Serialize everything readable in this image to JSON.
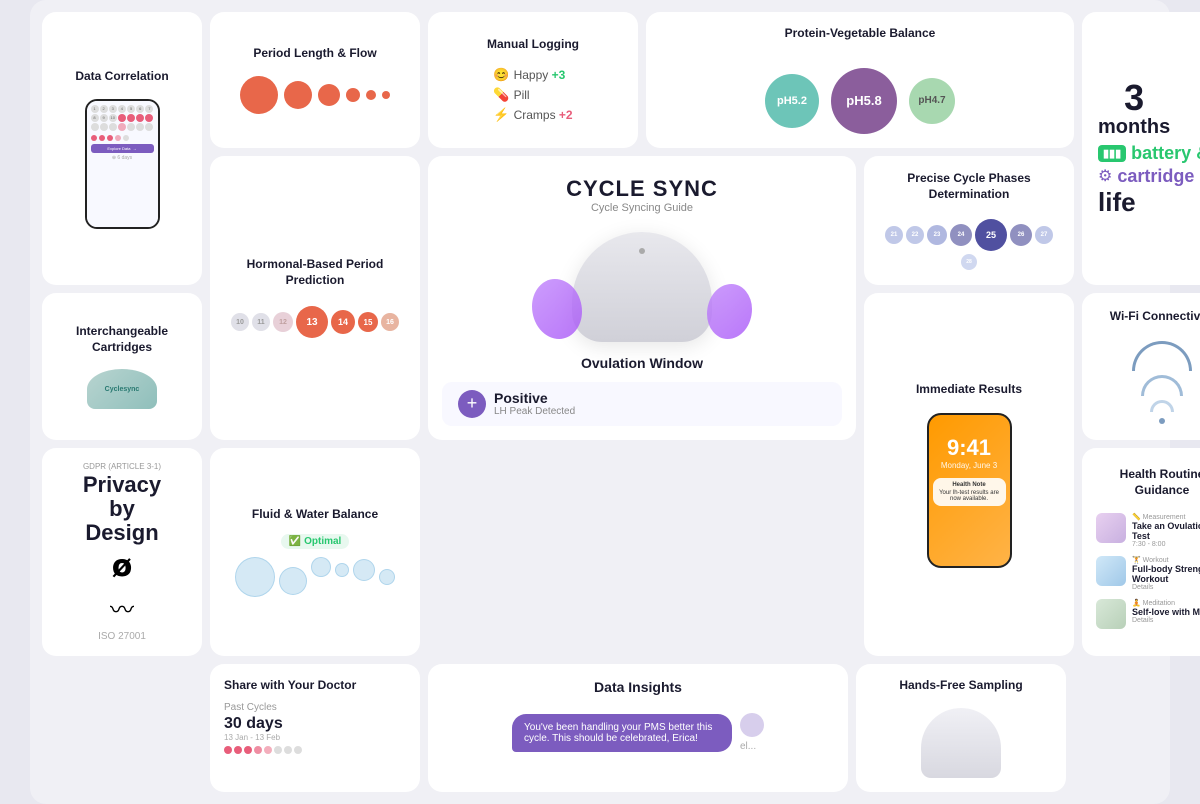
{
  "cards": {
    "data_correlation": {
      "title": "Data Correlation"
    },
    "period_flow": {
      "title": "Period Length & Flow",
      "circles": [
        38,
        28,
        22,
        14,
        10,
        8
      ]
    },
    "manual_logging": {
      "title": "Manual Logging",
      "items": [
        {
          "icon": "😊",
          "text": "Happy +3"
        },
        {
          "icon": "💊",
          "text": "Pill"
        },
        {
          "icon": "⚡",
          "text": "Cramps +2"
        }
      ]
    },
    "protein_veg": {
      "title": "Protein-Vegetable Balance",
      "circles": [
        {
          "label": "pH5.2",
          "size": 54,
          "color": "#6dc5b8"
        },
        {
          "label": "pH5.8",
          "size": 66,
          "color": "#8b5e9c"
        },
        {
          "label": "pH4.7",
          "size": 46,
          "color": "#a8d8b0"
        }
      ]
    },
    "months": {
      "number": "3",
      "label": "months",
      "battery": "battery &",
      "cartridge": "cartridge",
      "life": "life"
    },
    "cartridges": {
      "title": "Interchangeable Cartridges",
      "label": "Cyclesync"
    },
    "hormonal": {
      "title": "Hormonal-Based Period Prediction",
      "dots": [
        {
          "n": "10",
          "size": 18,
          "color": "#e0e0e8"
        },
        {
          "n": "11",
          "size": 18,
          "color": "#e0e0e8"
        },
        {
          "n": "12",
          "size": 20,
          "color": "#e8d0d8"
        },
        {
          "n": "13",
          "size": 28,
          "color": "#e8674a"
        },
        {
          "n": "14",
          "size": 24,
          "color": "#e8674a"
        },
        {
          "n": "15",
          "size": 20,
          "color": "#e8674a"
        },
        {
          "n": "16",
          "size": 18,
          "color": "#e8b4a0"
        }
      ]
    },
    "cycle_sync": {
      "title": "CYCLE SYNC",
      "subtitle": "Cycle Syncing Guide"
    },
    "precise": {
      "title": "Precise Cycle Phases Determination",
      "dots": [
        {
          "n": "21",
          "size": 18,
          "color": "#c0c8e8"
        },
        {
          "n": "22",
          "size": 18,
          "color": "#c0c8e8"
        },
        {
          "n": "23",
          "size": 20,
          "color": "#b0b8e0"
        },
        {
          "n": "24",
          "size": 22,
          "color": "#9090c0"
        },
        {
          "n": "25",
          "size": 30,
          "color": "#5050a0"
        },
        {
          "n": "26",
          "size": 22,
          "color": "#9090c0"
        },
        {
          "n": "27",
          "size": 18,
          "color": "#c0c8e8"
        },
        {
          "n": "28",
          "size": 16,
          "color": "#d0d8f0"
        }
      ]
    },
    "wifi": {
      "title": "Wi-Fi Connectivity"
    },
    "privacy": {
      "gdpr": "GDPR (ARTICLE 3-1)",
      "title": "Privacy by Design",
      "iso": "ISO 27001"
    },
    "fluid": {
      "title": "Fluid & Water Balance",
      "status": "Optimal"
    },
    "ovulation": {
      "title": "Ovulation Window",
      "status": "Positive",
      "detail": "LH Peak Detected"
    },
    "immediate": {
      "title": "Immediate Results",
      "time": "9:41",
      "date": "Monday, June 3",
      "notification": "Your lh-test results are now available."
    },
    "health_routine": {
      "title": "Health Routine Guidance",
      "items": [
        {
          "type": "Measurement",
          "name": "Take an Ovulation Test",
          "detail": "7:30 - 8:00",
          "color": "#e8d8f0"
        },
        {
          "type": "Workout",
          "name": "Full-body Strength Workout",
          "detail": "Details",
          "color": "#d0e8f0"
        },
        {
          "type": "Meditation",
          "name": "Self-love with Mal",
          "detail": "Details",
          "color": "#d0e0d8"
        }
      ]
    },
    "share_doctor": {
      "title": "Share with Your Doctor",
      "label": "Past Cycles",
      "days": "30 days",
      "dates": "13 Jan - 13 Feb"
    },
    "data_insights": {
      "title": "Data Insights",
      "message": "You've been handling your PMS better this cycle. This should be celebrated, Erica!"
    },
    "hands_free": {
      "title": "Hands-Free Sampling"
    }
  }
}
